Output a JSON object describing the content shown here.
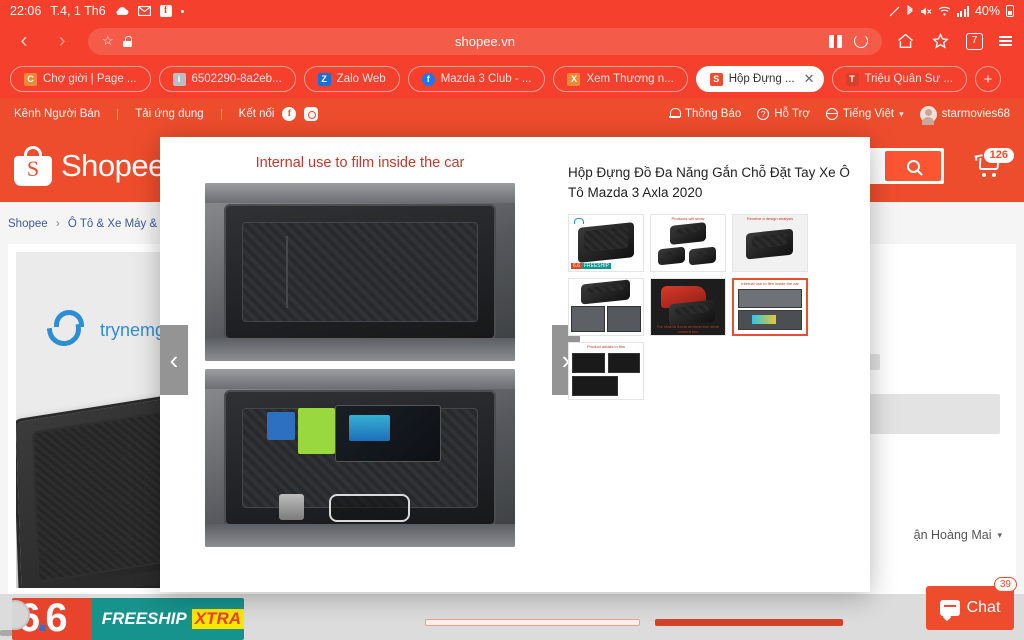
{
  "statusbar": {
    "time": "22:06",
    "date": "T.4, 1 Th6",
    "battery": "40%",
    "icons": [
      "cloud-icon",
      "gmail-icon",
      "facebook-icon",
      "dot-icon"
    ],
    "right_icons": [
      "screenshot-icon",
      "bluetooth-icon",
      "mute-icon",
      "wifi-icon",
      "signal-icon",
      "battery-icon"
    ]
  },
  "browser": {
    "back_icon": "‹",
    "forward_icon": "›",
    "url": "shopee.vn",
    "star_icon": "☆",
    "lock_icon": "lock-icon",
    "gift_icon": "gift-icon",
    "reload_icon": "reload-icon",
    "home_icon": "home-icon",
    "bookmark_icon": "bookmark-icon",
    "tab_count": "7",
    "menu_icon": "menu-icon"
  },
  "tabs": [
    {
      "label": "Chợ giời | Page ...",
      "favicon_color": "#f0883a",
      "favicon_letter": "C",
      "active": false
    },
    {
      "label": "6502290-8a2eb...",
      "favicon_color": "#b9bec4",
      "favicon_letter": "i",
      "active": false
    },
    {
      "label": "Zalo Web",
      "favicon_color": "#1d6fd8",
      "favicon_letter": "Z",
      "active": false
    },
    {
      "label": "Mazda 3 Club - ...",
      "favicon_color": "#1877f2",
      "favicon_letter": "f",
      "active": false
    },
    {
      "label": "Xem Thương n...",
      "favicon_color": "#f0883a",
      "favicon_letter": "X",
      "active": false
    },
    {
      "label": "Hộp Đựng ...",
      "favicon_color": "#ee4d2d",
      "favicon_letter": "S",
      "active": true
    },
    {
      "label": "Triệu Quân Sự ...",
      "favicon_color": "#d9402a",
      "favicon_letter": "T",
      "active": false
    }
  ],
  "tab_close_icon": "✕",
  "tab_new_icon": "+",
  "shopee_topnav": {
    "seller_channel": "Kênh Người Bán",
    "download_app": "Tải ứng dụng",
    "connect": "Kết nối",
    "facebook_icon": "facebook-icon",
    "instagram_icon": "instagram-icon",
    "notifications": "Thông Báo",
    "help": "Hỗ Trợ",
    "language": "Tiếng Việt",
    "username": "starmovies68"
  },
  "shopee_header": {
    "brand": "Shopee",
    "search_placeholder": "",
    "search_icon": "search-icon",
    "cart_icon": "cart-icon",
    "cart_count": "126"
  },
  "page": {
    "breadcrumb": [
      "Shopee",
      "Ô Tô & Xe Máy & Xe Đ"
    ],
    "breadcrumb_sep": "›",
    "brand_watermark": "trynemgo",
    "product_title_fragment": "Axla 2020",
    "delivery_location": "ận Hoàng Mai",
    "delivery_caret": "⌄"
  },
  "freeship_banner": {
    "number": "6.6",
    "text": "FREESHIP",
    "badge": "XTRA"
  },
  "chat_widget": {
    "label": "Chat",
    "badge": "39",
    "icon": "chat-icon"
  },
  "modal": {
    "heading": "Internal use to film inside the car",
    "title": "Hộp Đựng Đồ Đa Năng Gắn Chỗ Đặt Tay Xe Ô Tô Mazda 3 Axla 2020",
    "prev_icon": "‹",
    "next_icon": "›",
    "thumbnails": [
      {
        "caption": "",
        "selected": false,
        "kind": "product-logo-tag"
      },
      {
        "caption": "Products will show",
        "selected": false,
        "kind": "product-trio"
      },
      {
        "caption": "Receive a design analysis",
        "selected": false,
        "kind": "diagram"
      },
      {
        "caption": "",
        "selected": false,
        "kind": "compare"
      },
      {
        "caption": "For Mazda Axela armrest box store content box",
        "selected": false,
        "kind": "car"
      },
      {
        "caption": "Internal use to film inside the car",
        "selected": true,
        "kind": "installed"
      },
      {
        "caption": "Product details in film",
        "selected": false,
        "kind": "detail"
      }
    ]
  }
}
